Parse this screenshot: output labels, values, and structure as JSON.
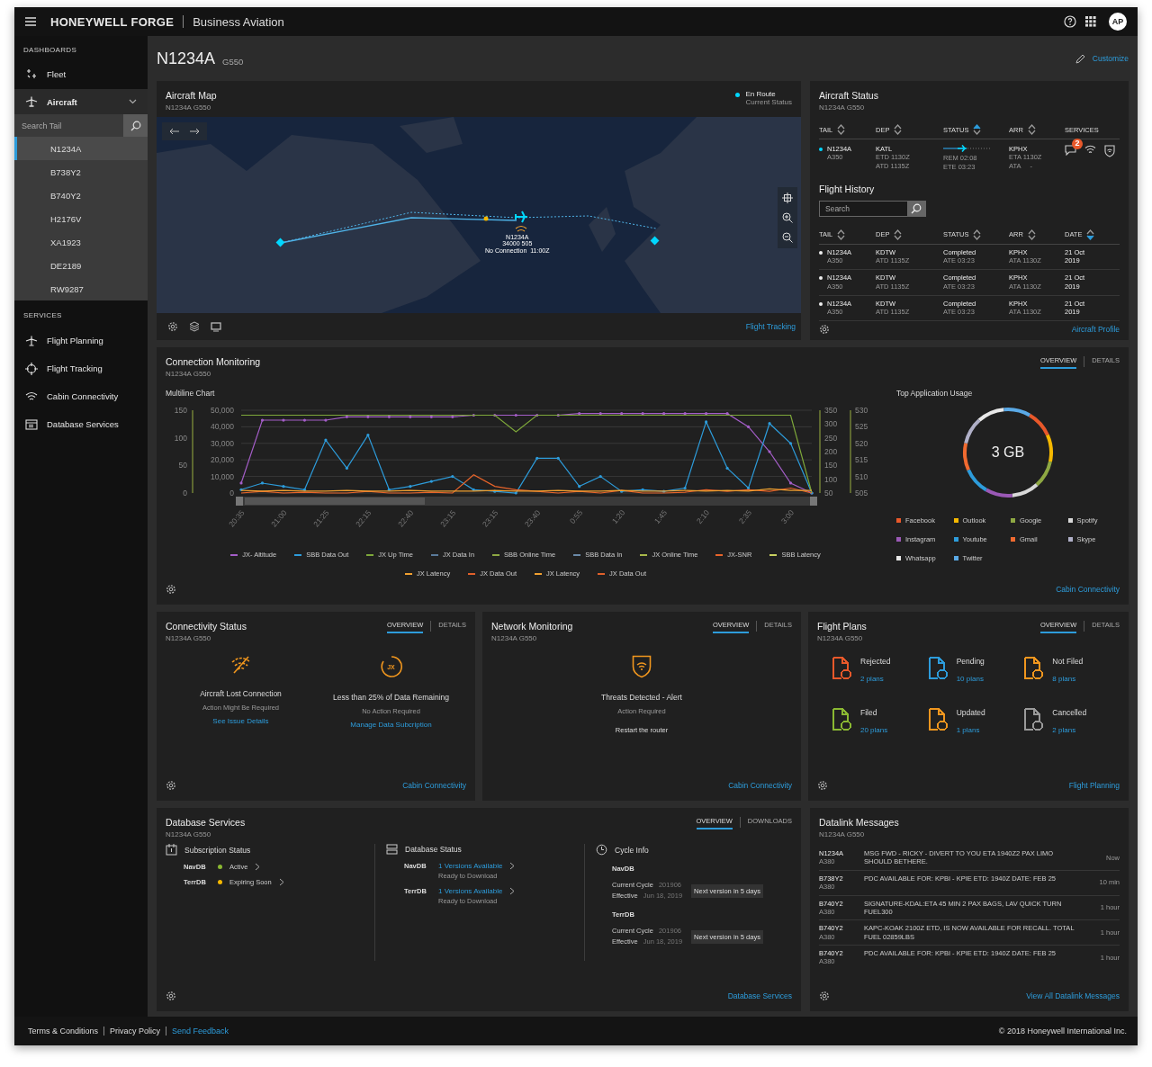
{
  "topbar": {
    "brand": "HONEYWELL FORGE",
    "product": "Business Aviation",
    "avatar": "AP"
  },
  "sidebar": {
    "dashboards_heading": "DASHBOARDS",
    "dashboards": [
      {
        "label": "Fleet",
        "selected": false,
        "expanded": false
      },
      {
        "label": "Aircraft",
        "selected": true,
        "expanded": true
      }
    ],
    "search": {
      "placeholder": "Search Tail"
    },
    "tails": [
      {
        "label": "N1234A",
        "selected": true
      },
      {
        "label": "B738Y2",
        "selected": false
      },
      {
        "label": "B740Y2",
        "selected": false
      },
      {
        "label": "H2176V",
        "selected": false
      },
      {
        "label": "XA1923",
        "selected": false
      },
      {
        "label": "DE2189",
        "selected": false
      },
      {
        "label": "RW9287",
        "selected": false
      }
    ],
    "services_heading": "SERVICES",
    "services": [
      {
        "label": "Flight Planning"
      },
      {
        "label": "Flight Tracking"
      },
      {
        "label": "Cabin Connectivity"
      },
      {
        "label": "Database Services"
      }
    ]
  },
  "page": {
    "title": "N1234A",
    "subtitle": "G550",
    "action": "Customize"
  },
  "map": {
    "title": "Aircraft Map",
    "subtitle": "N1234A G550",
    "status": "En Route",
    "status_caption": "Current Status",
    "aircraft_label": [
      "N1234A",
      "34000 505",
      "No Connection  11:00Z"
    ],
    "link": "Flight Tracking"
  },
  "aircraft_status": {
    "title": "Aircraft Status",
    "subtitle": "N1234A G550",
    "columns": [
      {
        "label": "TAIL",
        "sortable": true,
        "sorted_up": false,
        "sorted_down": false
      },
      {
        "label": "DEP",
        "sortable": true,
        "sorted_up": false,
        "sorted_down": false
      },
      {
        "label": "STATUS",
        "sortable": true,
        "sorted_up": true,
        "sorted_down": false
      },
      {
        "label": "ARR",
        "sortable": true,
        "sorted_up": false,
        "sorted_down": false
      },
      {
        "label": "SERVICES",
        "sortable": false,
        "sorted_up": false,
        "sorted_down": false
      }
    ],
    "row": {
      "tail": "N1234A",
      "type": "A350",
      "dep": "KATL",
      "dep_lines": [
        "ETD 1130Z",
        "ATD 1135Z"
      ],
      "status_lines": [
        "REM 02:08",
        "ETE 03:23"
      ],
      "arr": "KPHX",
      "arr_lines": [
        "ETA 1130Z",
        "ATA     -"
      ],
      "message_count": "2"
    },
    "history": {
      "title": "Flight History",
      "search_placeholder": "Search",
      "columns": [
        {
          "label": "TAIL",
          "sortable": true,
          "sorted_up": false,
          "sorted_down": false
        },
        {
          "label": "DEP",
          "sortable": true,
          "sorted_up": false,
          "sorted_down": false
        },
        {
          "label": "STATUS",
          "sortable": true,
          "sorted_up": false,
          "sorted_down": false
        },
        {
          "label": "ARR",
          "sortable": true,
          "sorted_up": false,
          "sorted_down": false
        },
        {
          "label": "DATE",
          "sortable": true,
          "sorted_up": false,
          "sorted_down": true
        }
      ],
      "rows": [
        {
          "tail": "N1234A",
          "type": "A350",
          "dep": "KDTW",
          "dep_time": "ATD 1135Z",
          "status": "Completed",
          "status_time": "ATE 03:23",
          "arr": "KPHX",
          "arr_time": "ATA 1130Z",
          "date": "21 Oct",
          "year": "2019"
        },
        {
          "tail": "N1234A",
          "type": "A350",
          "dep": "KDTW",
          "dep_time": "ATD 1135Z",
          "status": "Completed",
          "status_time": "ATE 03:23",
          "arr": "KPHX",
          "arr_time": "ATA 1130Z",
          "date": "21 Oct",
          "year": "2019"
        },
        {
          "tail": "N1234A",
          "type": "A350",
          "dep": "KDTW",
          "dep_time": "ATD 1135Z",
          "status": "Completed",
          "status_time": "ATE 03:23",
          "arr": "KPHX",
          "arr_time": "ATA 1130Z",
          "date": "21 Oct",
          "year": "2019"
        }
      ]
    },
    "link": "Aircraft Profile"
  },
  "connection": {
    "title": "Connection Monitoring",
    "subtitle": "N1234A G550",
    "tabs": [
      {
        "label": "OVERVIEW",
        "selected": true
      },
      {
        "label": "DETAILS",
        "selected": false
      }
    ],
    "chart_title": "Multiline Chart",
    "chart_axes": [
      {
        "ticks": [
          "150",
          "100",
          "50",
          "0"
        ]
      },
      {
        "ticks": [
          "350",
          "300",
          "250",
          "200",
          "150",
          "100",
          "50"
        ]
      },
      {
        "ticks": [
          "530",
          "525",
          "520",
          "515",
          "510",
          "505"
        ]
      }
    ],
    "chart_data": {
      "type": "line",
      "grid": true,
      "categories": [
        "20:35",
        null,
        "21:00",
        null,
        "21:25",
        null,
        "22:15",
        null,
        "22:40",
        null,
        "23:15",
        null,
        "23:15",
        null,
        "23:40",
        null,
        "0:55",
        null,
        "1:20",
        null,
        "1:45",
        null,
        "2:10",
        null,
        "2:35",
        null,
        "3:00",
        null
      ],
      "ylim": [
        0,
        50000
      ],
      "yticks": [
        {
          "value": 0,
          "label": "0"
        },
        {
          "value": 10000,
          "label": "10,000"
        },
        {
          "value": 20000,
          "label": "20,000"
        },
        {
          "value": 30000,
          "label": "30,000"
        },
        {
          "value": 40000,
          "label": "40,000"
        },
        {
          "value": 50000,
          "label": "50,000"
        }
      ],
      "series": [
        {
          "name": "JX- Altitude",
          "color": "#a45ec8",
          "values": [
            6000,
            44000,
            44000,
            44000,
            44000,
            46000,
            46000,
            46000,
            46000,
            46000,
            46000,
            47000,
            47000,
            47000,
            47000,
            47000,
            48000,
            48000,
            48000,
            48000,
            48000,
            48000,
            48000,
            48000,
            40000,
            25000,
            6000,
            0
          ]
        },
        {
          "name": "SBB Data Out",
          "color": "#2d9cdb",
          "values": [
            2000,
            6000,
            4000,
            2000,
            32000,
            15000,
            35000,
            2000,
            4000,
            7000,
            10000,
            2000,
            1000,
            0,
            21000,
            21000,
            4000,
            10000,
            1000,
            2000,
            1000,
            3000,
            43000,
            15000,
            3000,
            42000,
            30000,
            0
          ]
        },
        {
          "name": "JX Up Time",
          "color": "#7ea83a",
          "values": [
            47000,
            47000,
            47000,
            47000,
            47000,
            47000,
            47000,
            47000,
            47000,
            47000,
            47000,
            47000,
            47000,
            37000,
            47000,
            47000,
            47000,
            47000,
            47000,
            47000,
            47000,
            47000,
            47000,
            47000,
            47000,
            47000,
            47000,
            0
          ]
        },
        {
          "name": "JX Data In",
          "color": "#5a7a9a",
          "values": [
            null,
            null,
            null,
            null,
            null,
            null,
            null,
            null,
            null,
            null,
            null,
            null,
            null,
            null,
            null,
            null,
            null,
            null,
            null,
            null,
            null,
            null,
            null,
            null,
            null,
            null,
            null,
            null
          ]
        },
        {
          "name": "SBB Online Time",
          "color": "#8ea843",
          "values": [
            null,
            null,
            null,
            null,
            null,
            null,
            null,
            null,
            null,
            null,
            null,
            null,
            null,
            null,
            null,
            null,
            null,
            null,
            null,
            null,
            null,
            null,
            null,
            null,
            null,
            null,
            null,
            null
          ]
        },
        {
          "name": "SBB Data In",
          "color": "#6a8aa8",
          "values": [
            null,
            null,
            null,
            null,
            null,
            null,
            null,
            null,
            null,
            null,
            null,
            null,
            null,
            null,
            null,
            null,
            null,
            null,
            null,
            null,
            null,
            null,
            null,
            null,
            null,
            null,
            null,
            null
          ]
        },
        {
          "name": "JX Online Time",
          "color": "#a8b84a",
          "values": [
            null,
            null,
            null,
            null,
            null,
            null,
            null,
            null,
            null,
            null,
            null,
            null,
            null,
            null,
            null,
            null,
            null,
            null,
            null,
            null,
            null,
            null,
            null,
            null,
            null,
            null,
            null,
            null
          ]
        },
        {
          "name": "JX-SNR",
          "color": "#e8642a",
          "values": [
            0,
            1000,
            0,
            500,
            0,
            0,
            1000,
            0,
            0,
            500,
            0,
            11000,
            4000,
            2000,
            1000,
            0,
            1000,
            0,
            1500,
            0,
            0,
            500,
            2000,
            1000,
            2000,
            1000,
            3000,
            0
          ]
        },
        {
          "name": "SBB Latency",
          "color": "#c8d060",
          "values": [
            null,
            null,
            null,
            null,
            null,
            null,
            null,
            null,
            null,
            null,
            null,
            null,
            null,
            null,
            null,
            null,
            null,
            null,
            null,
            null,
            null,
            null,
            null,
            null,
            null,
            null,
            null,
            null
          ]
        },
        {
          "name": "JX Latency",
          "color": "#f0a030",
          "values": [
            1500,
            1200,
            1500,
            1200,
            1200,
            1500,
            1200,
            1200,
            1500,
            1200,
            1200,
            1200,
            1500,
            1200,
            1200,
            1500,
            1200,
            1200,
            1500,
            1200,
            1200,
            1500,
            1200,
            1500,
            1200,
            2500,
            1500,
            1500
          ]
        },
        {
          "name": "JX Data Out",
          "color": "#e0602a",
          "values": [
            null,
            null,
            null,
            null,
            null,
            null,
            null,
            null,
            null,
            null,
            null,
            null,
            null,
            null,
            null,
            null,
            null,
            null,
            null,
            null,
            null,
            null,
            null,
            null,
            null,
            null,
            null,
            null
          ]
        },
        {
          "name": "JX Latency",
          "color": "#f0a030",
          "values": [
            null,
            null,
            null,
            null,
            null,
            null,
            null,
            null,
            null,
            null,
            null,
            null,
            null,
            null,
            null,
            null,
            null,
            null,
            null,
            null,
            null,
            null,
            null,
            null,
            null,
            null,
            null,
            null
          ]
        },
        {
          "name": "JX Data Out",
          "color": "#e0602a",
          "values": [
            null,
            null,
            null,
            null,
            null,
            null,
            null,
            null,
            null,
            null,
            null,
            null,
            null,
            null,
            null,
            null,
            null,
            null,
            null,
            null,
            null,
            null,
            null,
            null,
            null,
            null,
            null,
            null
          ]
        }
      ]
    },
    "usage": {
      "title": "Top Application Usage",
      "total": "3 GB",
      "apps": [
        {
          "label": "Facebook",
          "color": "#e8582a"
        },
        {
          "label": "Outlook",
          "color": "#f5b800"
        },
        {
          "label": "Google",
          "color": "#8ea843"
        },
        {
          "label": "Spotify",
          "color": "#d8d8d8"
        },
        {
          "label": "Instagram",
          "color": "#9b59b6"
        },
        {
          "label": "Youtube",
          "color": "#2d9cdb"
        },
        {
          "label": "Gmail",
          "color": "#f06a30"
        },
        {
          "label": "Skype",
          "color": "#b0b0c8"
        },
        {
          "label": "Whatsapp",
          "color": "#e8e8e8"
        },
        {
          "label": "Twitter",
          "color": "#5aa9e6"
        }
      ]
    },
    "link": "Cabin Connectivity"
  },
  "connectivity": {
    "title": "Connectivity Status",
    "subtitle": "N1234A G550",
    "tabs": [
      {
        "label": "OVERVIEW",
        "selected": true
      },
      {
        "label": "DETAILS",
        "selected": false
      }
    ],
    "items": [
      {
        "kind": "signal",
        "title": "Aircraft Lost Connection",
        "note": "Action Might Be Required",
        "link": "See Issue Details"
      },
      {
        "kind": "data",
        "badge": "JX",
        "title": "Less than 25% of Data Remaining",
        "note": "No Action Required",
        "link": "Manage Data Subcription"
      }
    ],
    "link": "Cabin Connectivity"
  },
  "network": {
    "title": "Network Monitoring",
    "subtitle": "N1234A G550",
    "tabs": [
      {
        "label": "OVERVIEW",
        "selected": true
      },
      {
        "label": "DETAILS",
        "selected": false
      }
    ],
    "alert": "Threats Detected - Alert",
    "note": "Action Required",
    "action": "Restart the router",
    "link": "Cabin Connectivity"
  },
  "flight_plans": {
    "title": "Flight Plans",
    "subtitle": "N1234A G550",
    "tabs": [
      {
        "label": "OVERVIEW",
        "selected": true
      },
      {
        "label": "DETAILS",
        "selected": false
      }
    ],
    "items": [
      {
        "label": "Rejected",
        "count": "2 plans",
        "color": "#e8582a"
      },
      {
        "label": "Pending",
        "count": "10 plans",
        "color": "#2d9cdb"
      },
      {
        "label": "Not Filed",
        "count": "8 plans",
        "color": "#f0961e"
      },
      {
        "label": "Filed",
        "count": "20 plans",
        "color": "#8ab832"
      },
      {
        "label": "Updated",
        "count": "1 plans",
        "color": "#f0961e"
      },
      {
        "label": "Cancelled",
        "count": "2 plans",
        "color": "#9a9a9a"
      }
    ],
    "link": "Flight Planning"
  },
  "database": {
    "title": "Database Services",
    "subtitle": "N1234A G550",
    "tabs": [
      {
        "label": "OVERVIEW",
        "selected": true
      },
      {
        "label": "DOWNLOADS",
        "selected": false
      }
    ],
    "subscription": {
      "title": "Subscription Status",
      "items": [
        {
          "db": "NavDB",
          "status": "Active",
          "color": "#8ab832"
        },
        {
          "db": "TerrDB",
          "status": "Expiring Soon",
          "color": "#f5b800"
        }
      ]
    },
    "status": {
      "title": "Database Status",
      "items": [
        {
          "db": "NavDB",
          "link": "1 Versions Available",
          "note": "Ready to Download"
        },
        {
          "db": "TerrDB",
          "link": "1 Versions Available",
          "note": "Ready to Download"
        }
      ]
    },
    "cycle": {
      "title": "Cycle Info",
      "items": [
        {
          "db": "NavDB",
          "current_label": "Current Cycle",
          "current": "201906",
          "effective_label": "Effective",
          "effective": "Jun 18, 2019",
          "badge": "Next version in 5 days"
        },
        {
          "db": "TerrDB",
          "current_label": "Current Cycle",
          "current": "201906",
          "effective_label": "Effective",
          "effective": "Jun 18, 2019",
          "badge": "Next version in 5 days"
        }
      ]
    },
    "link": "Database Services"
  },
  "datalink": {
    "title": "Datalink Messages",
    "subtitle": "N1234A G550",
    "messages": [
      {
        "tail": "N1234A",
        "type": "A380",
        "text": "MSG FWD - RICKY - DIVERT TO YOU ETA 1940Z2 PAX LIMO SHOULD BETHERE.",
        "time": "Now"
      },
      {
        "tail": "B738Y2",
        "type": "A380",
        "text": "PDC AVAILABLE FOR: KPBI - KPIE ETD: 1940Z DATE: FEB 25",
        "time": "10 min"
      },
      {
        "tail": "B740Y2",
        "type": "A380",
        "text": "SIGNATURE-KDAL:ETA 45 MIN 2 PAX BAGS, LAV QUICK TURN FUEL300",
        "time": "1 hour"
      },
      {
        "tail": "B740Y2",
        "type": "A380",
        "text": "KAPC-KOAK 2100Z ETD, IS NOW AVAILABLE FOR RECALL. TOTAL FUEL 02859LBS",
        "time": "1 hour"
      },
      {
        "tail": "B740Y2",
        "type": "A380",
        "text": "PDC AVAILABLE FOR: KPBI - KPIE ETD: 1940Z DATE: FEB 25",
        "time": "1 hour"
      }
    ],
    "link": "View All Datalink Messages"
  },
  "footer": {
    "links": [
      {
        "label": "Terms & Conditions",
        "emphasis": false
      },
      {
        "label": "Privacy Policy",
        "emphasis": false
      },
      {
        "label": "Send Feedback",
        "emphasis": true
      }
    ],
    "copyright": "© 2018 Honeywell International Inc."
  }
}
